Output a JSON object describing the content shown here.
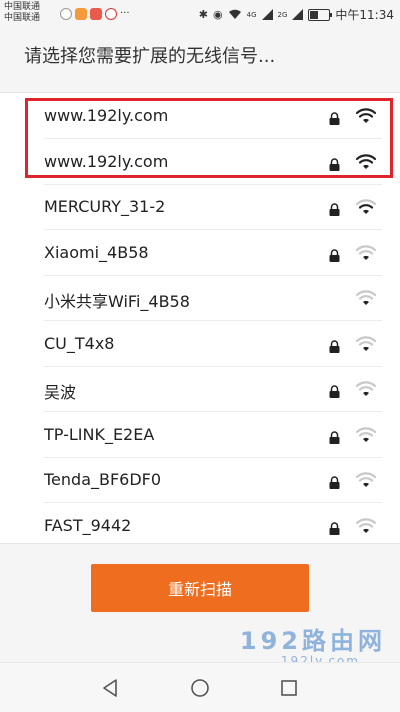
{
  "status_bar": {
    "carrier_1": "中国联通",
    "carrier_2": "中国联通",
    "network_badge_1": "4G",
    "network_badge_2": "2G",
    "time": "中午11:34"
  },
  "header": {
    "title": "请选择您需要扩展的无线信号..."
  },
  "networks": [
    {
      "ssid": "www.192ly.com",
      "locked": true,
      "signal": "strong"
    },
    {
      "ssid": "www.192ly.com",
      "locked": true,
      "signal": "strong"
    },
    {
      "ssid": "MERCURY_31-2",
      "locked": true,
      "signal": "medium"
    },
    {
      "ssid": "Xiaomi_4B58",
      "locked": true,
      "signal": "weak"
    },
    {
      "ssid": "小米共享WiFi_4B58",
      "locked": false,
      "signal": "weak"
    },
    {
      "ssid": "CU_T4x8",
      "locked": true,
      "signal": "weak"
    },
    {
      "ssid": "吴波",
      "locked": true,
      "signal": "weak"
    },
    {
      "ssid": "TP-LINK_E2EA",
      "locked": true,
      "signal": "weak"
    },
    {
      "ssid": "Tenda_BF6DF0",
      "locked": true,
      "signal": "weak"
    },
    {
      "ssid": "FAST_9442",
      "locked": true,
      "signal": "weak"
    }
  ],
  "rescan_button": {
    "label": "重新扫描"
  },
  "watermark": {
    "main": "192路由网",
    "sub": "192ly.com"
  },
  "colors": {
    "accent": "#ee6d1f",
    "highlight": "#e0242b",
    "watermark": "#8fb3dc"
  },
  "icons": {
    "lock": "lock-icon",
    "wifi": "wifi-icon",
    "back": "back-icon",
    "home": "home-icon",
    "recent": "recent-apps-icon"
  }
}
